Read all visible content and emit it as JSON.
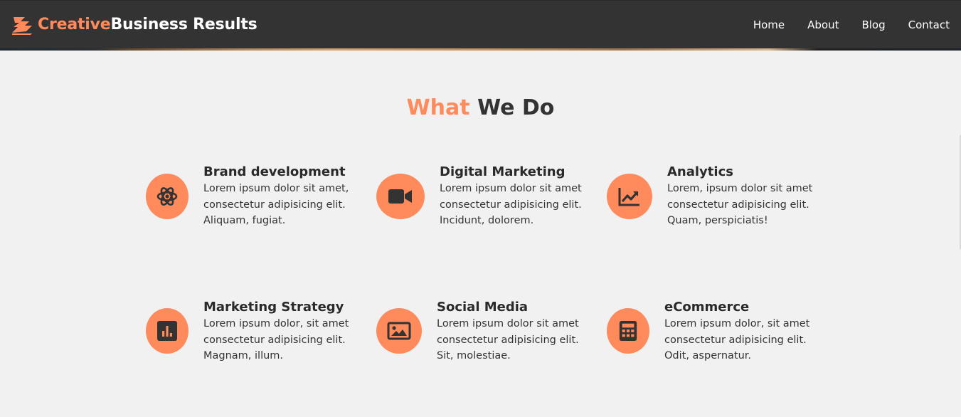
{
  "brand": {
    "accent": "Creative",
    "main": "Business Results",
    "accent_color": "#ff8a5c"
  },
  "nav": {
    "items": [
      {
        "label": "Home"
      },
      {
        "label": "About"
      },
      {
        "label": "Blog"
      },
      {
        "label": "Contact"
      }
    ]
  },
  "section": {
    "title_accent": "What",
    "title_main": "We Do"
  },
  "services": [
    {
      "title": "Brand development",
      "lines": [
        "Lorem ipsum dolor sit amet,",
        "consectetur adipisicing elit.",
        "Aliquam, fugiat."
      ],
      "icon": "atom-icon"
    },
    {
      "title": "Digital Marketing",
      "lines": [
        "Lorem ipsum dolor sit amet",
        "consectetur adipisicing elit.",
        "Incidunt, dolorem."
      ],
      "icon": "video-camera-icon"
    },
    {
      "title": "Analytics",
      "lines": [
        "Lorem, ipsum dolor sit amet",
        "consectetur adipisicing elit.",
        "Quam, perspiciatis!"
      ],
      "icon": "chart-line-icon"
    },
    {
      "title": "Marketing Strategy",
      "lines": [
        "Lorem ipsum dolor, sit amet",
        "consectetur adipisicing elit.",
        "Magnam, illum."
      ],
      "icon": "bar-chart-icon"
    },
    {
      "title": "Social Media",
      "lines": [
        "Lorem ipsum dolor sit amet",
        "consectetur adipisicing elit.",
        "Sit, molestiae."
      ],
      "icon": "image-icon"
    },
    {
      "title": "eCommerce",
      "lines": [
        "Lorem ipsum dolor, sit amet",
        "consectetur adipisicing elit.",
        "Odit, aspernatur."
      ],
      "icon": "calculator-icon"
    }
  ]
}
